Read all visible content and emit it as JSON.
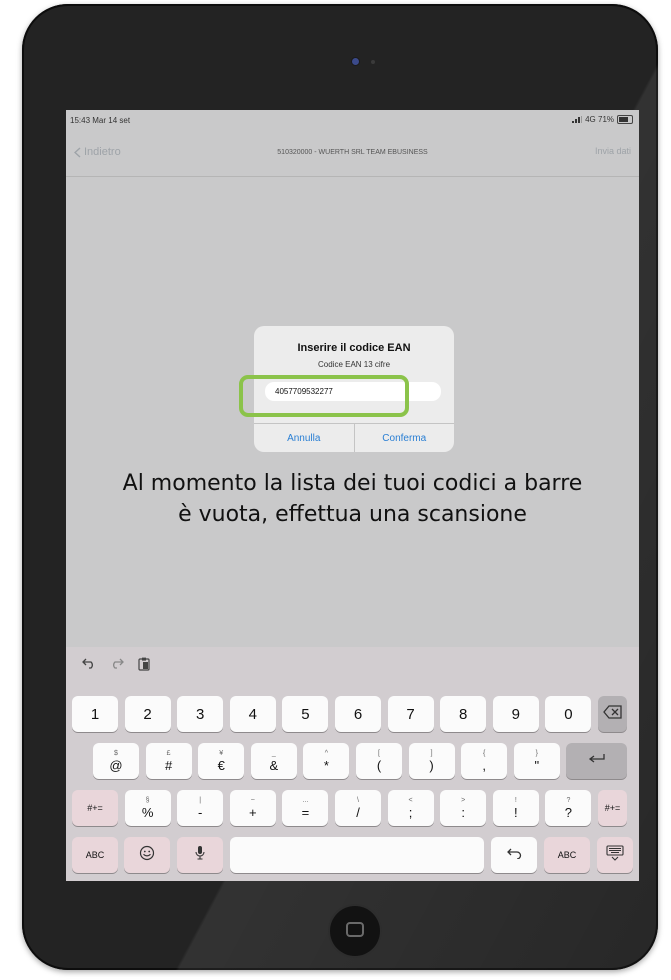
{
  "status": {
    "time": "15:43  Mar 14 set",
    "network": "4G 71%",
    "battery_level": 0.71
  },
  "nav": {
    "back_label": "Indietro",
    "title": "510320000 - WUERTH SRL TEAM EBUSINESS",
    "action_label": "Invia dati"
  },
  "empty_message": {
    "line1": "Al momento la lista dei tuoi codici a barre",
    "line2": "è vuota, effettua una scansione"
  },
  "alert": {
    "title": "Inserire il codice EAN",
    "message": "Codice EAN 13 cifre",
    "input_value": "4057709532277",
    "cancel_label": "Annulla",
    "confirm_label": "Conferma"
  },
  "keyboard": {
    "shortcuts": [
      "undo-icon",
      "redo-icon",
      "paste-icon"
    ],
    "number_row": [
      "1",
      "2",
      "3",
      "4",
      "5",
      "6",
      "7",
      "8",
      "9",
      "0"
    ],
    "row2": [
      {
        "sec": "$",
        "pri": "@"
      },
      {
        "sec": "£",
        "pri": "#"
      },
      {
        "sec": "¥",
        "pri": "€"
      },
      {
        "sec": "_",
        "pri": "&"
      },
      {
        "sec": "^",
        "pri": "*"
      },
      {
        "sec": "[",
        "pri": "("
      },
      {
        "sec": "]",
        "pri": ")"
      },
      {
        "sec": "{",
        "pri": ","
      },
      {
        "sec": "}",
        "pri": "\""
      }
    ],
    "row3": [
      {
        "sec": "§",
        "pri": "%"
      },
      {
        "sec": "|",
        "pri": "-"
      },
      {
        "sec": "~",
        "pri": "+"
      },
      {
        "sec": "...",
        "pri": "="
      },
      {
        "sec": "\\",
        "pri": "/"
      },
      {
        "sec": "<",
        "pri": ";"
      },
      {
        "sec": ">",
        "pri": ":"
      },
      {
        "sec": "!",
        "pri": "!"
      },
      {
        "sec": "?",
        "pri": "?"
      }
    ],
    "symbols_label": "#+=",
    "abc_label": "ABC",
    "icons": {
      "delete": "backspace-icon",
      "return": "return-icon",
      "emoji": "emoji-icon",
      "mic": "microphone-icon",
      "undo": "undo-icon",
      "hide": "hide-keyboard-icon"
    }
  },
  "colors": {
    "highlight": "#8bc34a",
    "alert_button": "#2a7fd4"
  }
}
